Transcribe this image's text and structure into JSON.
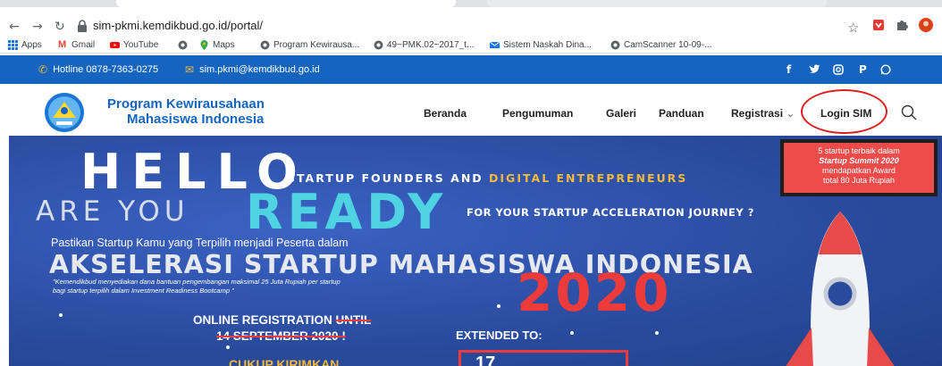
{
  "browser": {
    "url": "sim-pkmi.kemdikbud.go.id/portal/",
    "bookmarks": [
      "Apps",
      "Gmail",
      "YouTube",
      "Maps",
      "Program Kewirausa...",
      "49~PMK.02~2017_t...",
      "Sistem Naskah Dina...",
      "CamScanner 10-09-..."
    ]
  },
  "topbar": {
    "hotline": "Hotline 0878-7363-0275",
    "email": "sim.pkmi@kemdikbud.go.id",
    "social": [
      "f",
      "t",
      "ig",
      "p",
      "wa"
    ]
  },
  "header": {
    "brand_line1": "Program Kewirausahaan",
    "brand_line2": "Mahasiswa Indonesia",
    "menu": [
      "Beranda",
      "Pengumuman",
      "Galeri",
      "Panduan",
      "Registrasi",
      "Login SIM"
    ]
  },
  "hero": {
    "hello": "HELLO",
    "tagline_a": "STARTUP FOUNDERS AND ",
    "tagline_b": "DIGITAL ENTREPRENEURS",
    "are_you": "ARE YOU",
    "ready": "READY",
    "journey": "FOR YOUR STARTUP ACCELERATION JOURNEY ?",
    "pastikan": "Pastikan Startup Kamu yang Terpilih menjadi Peserta dalam",
    "akselerasi": "AKSELERASI STARTUP MAHASISWA INDONESIA",
    "note_line1": "\"Kemendikbud menyediakan dana bantuan pengembangan maksimal 25 Juta Rupiah per startup",
    "note_line2": "bagi startup terpilih dalam Investment Readiness Bootcamp \"",
    "year": "2020",
    "online_reg": "ONLINE REGISTRATION ",
    "until": "UNTIL",
    "sept": "14 SEPTEMBER 2020 !",
    "extended": "EXTENDED TO:",
    "cukup": "CUKUP KIRIMKAN",
    "daynum": "17"
  },
  "promo": {
    "line1": "5 startup terbaik dalam",
    "line2": "Startup Summit 2020",
    "line3": "mendapatkan Award",
    "line4": "total 80 Juta Rupiah"
  },
  "colors": {
    "topbar": "#1565c0",
    "hero_bg": "#2a4b9e",
    "ready": "#4fd3e3",
    "accent_red": "#ed3b3b",
    "accent_yellow": "#f6b93b"
  }
}
